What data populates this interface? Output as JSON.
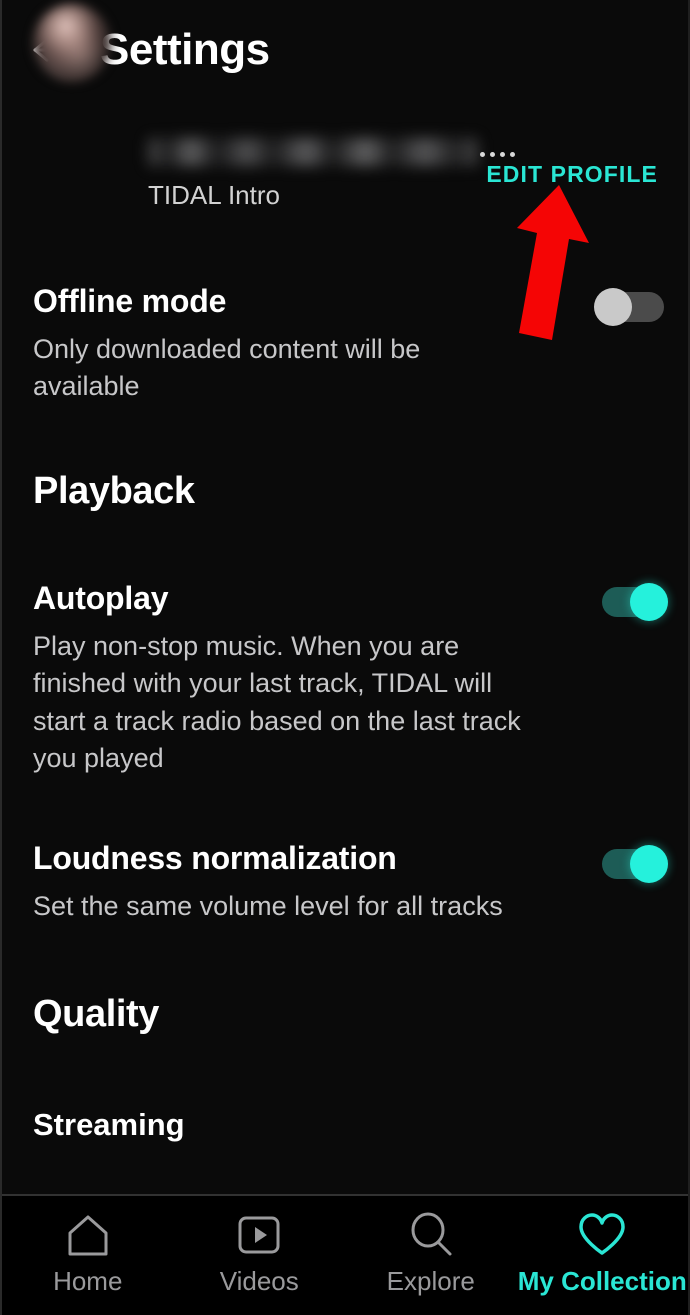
{
  "header": {
    "title": "Settings",
    "back_icon": "arrow-left-icon"
  },
  "profile": {
    "username_redacted": "",
    "username_overflow_dots": "....",
    "subtitle": "TIDAL Intro",
    "edit_label": "EDIT PROFILE",
    "avatar_icon": "user-avatar-photo"
  },
  "settings": {
    "offline_mode": {
      "title": "Offline mode",
      "description": "Only downloaded content will be available",
      "toggle_state": "off"
    },
    "playback_section": {
      "header": "Playback"
    },
    "autoplay": {
      "title": "Autoplay",
      "description": "Play non-stop music. When you are finished with your last track, TIDAL will start a track radio based on the last track you played",
      "toggle_state": "on"
    },
    "loudness": {
      "title": "Loudness normalization",
      "description": "Set the same volume level for all tracks",
      "toggle_state": "on"
    },
    "quality_section": {
      "header": "Quality"
    },
    "streaming": {
      "label": "Streaming"
    }
  },
  "annotation": {
    "arrow_color": "#f50505",
    "points_to": "EDIT PROFILE"
  },
  "bottom_nav": {
    "items": [
      {
        "label": "Home",
        "icon": "home-icon",
        "active": false
      },
      {
        "label": "Videos",
        "icon": "video-icon",
        "active": false
      },
      {
        "label": "Explore",
        "icon": "search-icon",
        "active": false
      },
      {
        "label": "My Collection",
        "icon": "heart-icon",
        "active": true
      }
    ]
  },
  "colors": {
    "accent": "#2ae6d4",
    "toggle_on": "#25f1dc",
    "toggle_off": "#c9c9c9",
    "background": "#0a0a0a",
    "annotation_red": "#f50505"
  }
}
